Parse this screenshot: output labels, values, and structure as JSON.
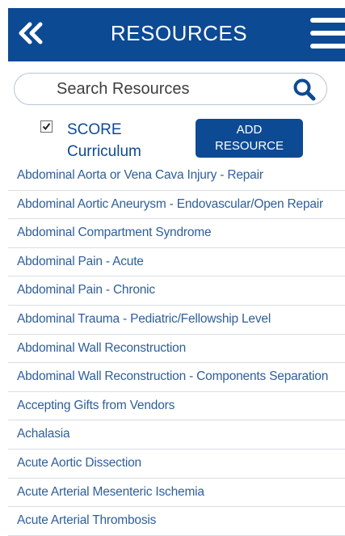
{
  "header": {
    "title": "RESOURCES",
    "back_icon": "double-chevron-left-icon",
    "menu_icon": "hamburger-menu-icon"
  },
  "search": {
    "placeholder": "Search Resources",
    "value": "",
    "icon": "search-icon"
  },
  "filter": {
    "checked": true,
    "label": "SCORE Curriculum"
  },
  "add_button": {
    "line1": "ADD",
    "line2": "RESOURCE"
  },
  "resources": [
    {
      "label": "Abdominal Aorta or Vena Cava Injury - Repair"
    },
    {
      "label": "Abdominal Aortic Aneurysm - Endovascular/Open Repair"
    },
    {
      "label": "Abdominal Compartment Syndrome"
    },
    {
      "label": "Abdominal Pain - Acute"
    },
    {
      "label": "Abdominal Pain - Chronic"
    },
    {
      "label": "Abdominal Trauma - Pediatric/Fellowship Level"
    },
    {
      "label": "Abdominal Wall Reconstruction"
    },
    {
      "label": "Abdominal Wall Reconstruction - Components Separation"
    },
    {
      "label": "Accepting Gifts from Vendors"
    },
    {
      "label": "Achalasia"
    },
    {
      "label": "Acute Aortic Dissection"
    },
    {
      "label": "Acute Arterial Mesenteric Ischemia"
    },
    {
      "label": "Acute Arterial Thrombosis"
    }
  ],
  "colors": {
    "brand": "#0d4a94",
    "link": "#2f5f99",
    "divider": "#d8dee6"
  }
}
